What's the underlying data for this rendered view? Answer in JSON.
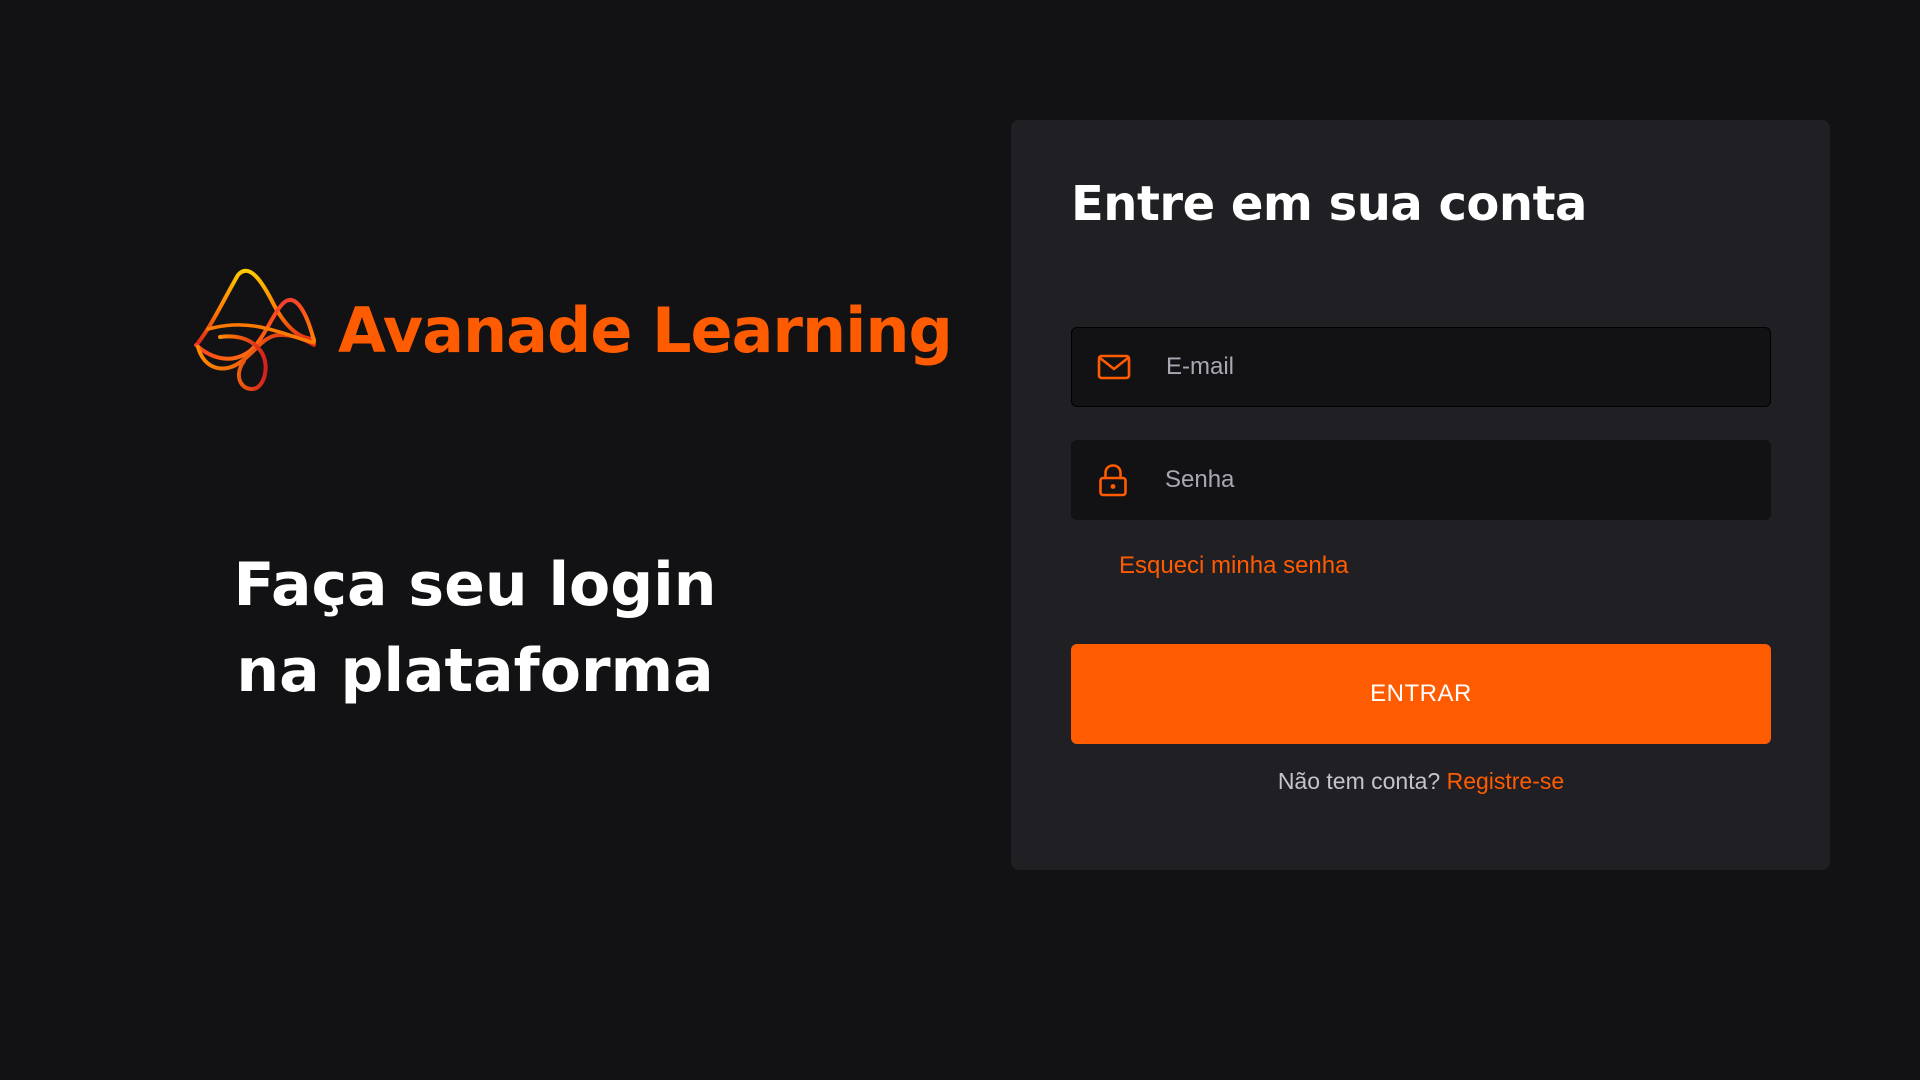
{
  "brand": {
    "name": "Avanade Learning",
    "logo_icon": "avanade-wave-logo",
    "accent_color": "#ff5b00"
  },
  "hero": {
    "tagline_line1": "Faça seu login",
    "tagline_line2": "na plataforma"
  },
  "login_card": {
    "title": "Entre em sua conta",
    "email": {
      "icon": "mail-icon",
      "placeholder": "E-mail",
      "value": ""
    },
    "password": {
      "icon": "lock-icon",
      "placeholder": "Senha",
      "value": ""
    },
    "forgot_password_label": "Esqueci minha senha",
    "submit_label": "ENTRAR",
    "no_account_text": "Não tem conta?",
    "register_label": "Registre-se"
  },
  "colors": {
    "background": "#121214",
    "card": "#202024",
    "input": "#121214",
    "accent": "#ff5b00",
    "text_primary": "#ffffff",
    "text_muted": "#a8a8b3"
  }
}
